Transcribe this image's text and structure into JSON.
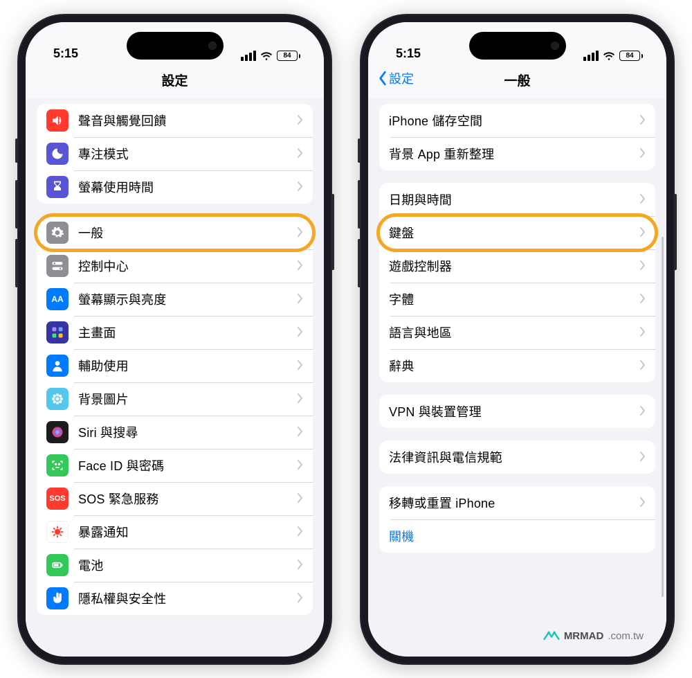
{
  "status": {
    "time": "5:15",
    "battery": "84"
  },
  "left": {
    "title": "設定",
    "groupA": [
      {
        "label": "聲音與觸覺回饋",
        "icon": "sound",
        "color": "#ff3b30"
      },
      {
        "label": "專注模式",
        "icon": "moon",
        "color": "#5856d6"
      },
      {
        "label": "螢幕使用時間",
        "icon": "hourglass",
        "color": "#5856d6"
      }
    ],
    "groupB": [
      {
        "label": "一般",
        "icon": "gear",
        "color": "#8e8e93"
      },
      {
        "label": "控制中心",
        "icon": "switches",
        "color": "#8e8e93"
      },
      {
        "label": "螢幕顯示與亮度",
        "icon": "aa",
        "color": "#007aff"
      },
      {
        "label": "主畫面",
        "icon": "grid",
        "color": "#3634a3"
      },
      {
        "label": "輔助使用",
        "icon": "person",
        "color": "#007aff"
      },
      {
        "label": "背景圖片",
        "icon": "flower",
        "color": "#54c7ec"
      },
      {
        "label": "Siri 與搜尋",
        "icon": "siri",
        "color": "#1c1c1e"
      },
      {
        "label": "Face ID 與密碼",
        "icon": "faceid",
        "color": "#34c759"
      },
      {
        "label": "SOS 緊急服務",
        "icon": "sos",
        "color": "#ff3b30"
      },
      {
        "label": "暴露通知",
        "icon": "virus",
        "color": "#ffffff"
      },
      {
        "label": "電池",
        "icon": "battery",
        "color": "#34c759"
      },
      {
        "label": "隱私權與安全性",
        "icon": "hand",
        "color": "#007aff"
      }
    ],
    "highlight_index_groupB": 0
  },
  "right": {
    "title": "一般",
    "back": "設定",
    "groupA": [
      {
        "label": "iPhone 儲存空間"
      },
      {
        "label": "背景 App 重新整理"
      }
    ],
    "groupB": [
      {
        "label": "日期與時間"
      },
      {
        "label": "鍵盤"
      },
      {
        "label": "遊戲控制器"
      },
      {
        "label": "字體"
      },
      {
        "label": "語言與地區"
      },
      {
        "label": "辭典"
      }
    ],
    "groupC": [
      {
        "label": "VPN 與裝置管理"
      }
    ],
    "groupD": [
      {
        "label": "法律資訊與電信規範"
      }
    ],
    "groupE": [
      {
        "label": "移轉或重置 iPhone"
      },
      {
        "label": "關機",
        "link": true,
        "no_chevron": true
      }
    ],
    "highlight_index_groupB": 1
  },
  "watermark": {
    "brand": "MRMAD",
    "domain": ".com.tw"
  }
}
